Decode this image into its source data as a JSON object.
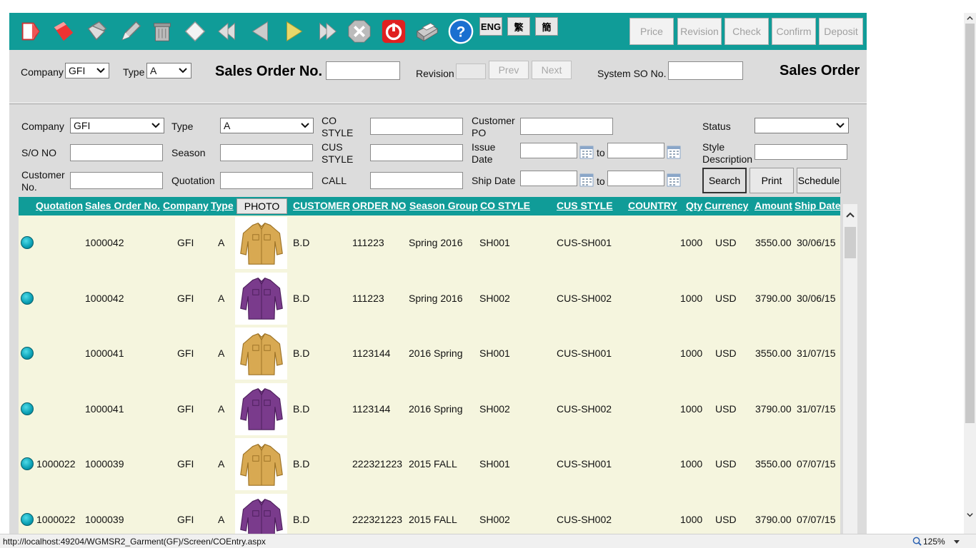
{
  "toolbar": {
    "icons": [
      "new-document-icon",
      "tag-icon",
      "duplicate-icon",
      "edit-pencil-icon",
      "delete-bin-icon",
      "diamond-icon",
      "first-record-icon",
      "previous-record-icon",
      "play-icon",
      "last-record-icon",
      "cancel-x-icon",
      "power-icon",
      "printer-icon",
      "help-icon"
    ],
    "lang": [
      "ENG",
      "繁",
      "簡"
    ],
    "workflow": [
      "Price",
      "Revision",
      "Check",
      "Confirm",
      "Deposit"
    ]
  },
  "header": {
    "company_label": "Company",
    "company_value": "GFI",
    "type_label": "Type",
    "type_value": "A",
    "so_label": "Sales Order No.",
    "revision_label": "Revision",
    "prev_label": "Prev",
    "next_label": "Next",
    "system_so_label": "System SO No.",
    "title": "Sales Order"
  },
  "filter": {
    "company_label": "Company",
    "company_value": "GFI",
    "type_label": "Type",
    "type_value": "A",
    "co_style_label": "CO STYLE",
    "customer_po_label": "Customer PO",
    "status_label": "Status",
    "so_no_label": "S/O NO",
    "season_label": "Season",
    "cus_style_label": "CUS STYLE",
    "issue_date_label": "Issue Date",
    "to_label": "to",
    "style_desc_label": "Style Description",
    "customer_no_label": "Customer No.",
    "quotation_label": "Quotation",
    "call_label": "CALL",
    "ship_date_label": "Ship Date",
    "search_btn": "Search",
    "print_btn": "Print",
    "schedule_btn": "Schedule"
  },
  "grid": {
    "columns": [
      "Quotation",
      "Sales Order No.",
      "Company",
      "Type",
      "PHOTO",
      "CUSTOMER",
      "ORDER NO",
      "Season Group",
      "CO STYLE",
      "CUS STYLE",
      "COUNTRY",
      "Qty",
      "Currency",
      "Amount",
      "Ship Date"
    ],
    "rows": [
      {
        "quotation": "",
        "so": "1000042",
        "company": "GFI",
        "type": "A",
        "photo": "yellow-shirt",
        "customer": "B.D",
        "order_no": "111223",
        "season": "Spring 2016",
        "co_style": "SH001",
        "cus_style": "CUS-SH001",
        "country": "",
        "qty": "1000",
        "currency": "USD",
        "amount": "3550.00",
        "ship": "30/06/15"
      },
      {
        "quotation": "",
        "so": "1000042",
        "company": "GFI",
        "type": "A",
        "photo": "purple-shirt",
        "customer": "B.D",
        "order_no": "111223",
        "season": "Spring 2016",
        "co_style": "SH002",
        "cus_style": "CUS-SH002",
        "country": "",
        "qty": "1000",
        "currency": "USD",
        "amount": "3790.00",
        "ship": "30/06/15"
      },
      {
        "quotation": "",
        "so": "1000041",
        "company": "GFI",
        "type": "A",
        "photo": "yellow-shirt",
        "customer": "B.D",
        "order_no": "1123144",
        "season": "2016 Spring",
        "co_style": "SH001",
        "cus_style": "CUS-SH001",
        "country": "",
        "qty": "1000",
        "currency": "USD",
        "amount": "3550.00",
        "ship": "31/07/15"
      },
      {
        "quotation": "",
        "so": "1000041",
        "company": "GFI",
        "type": "A",
        "photo": "purple-shirt",
        "customer": "B.D",
        "order_no": "1123144",
        "season": "2016 Spring",
        "co_style": "SH002",
        "cus_style": "CUS-SH002",
        "country": "",
        "qty": "1000",
        "currency": "USD",
        "amount": "3790.00",
        "ship": "31/07/15"
      },
      {
        "quotation": "1000022",
        "so": "1000039",
        "company": "GFI",
        "type": "A",
        "photo": "yellow-shirt",
        "customer": "B.D",
        "order_no": "222321223",
        "season": "2015 FALL",
        "co_style": "SH001",
        "cus_style": "CUS-SH001",
        "country": "",
        "qty": "1000",
        "currency": "USD",
        "amount": "3550.00",
        "ship": "07/07/15"
      },
      {
        "quotation": "1000022",
        "so": "1000039",
        "company": "GFI",
        "type": "A",
        "photo": "purple-shirt",
        "customer": "B.D",
        "order_no": "222321223",
        "season": "2015 FALL",
        "co_style": "SH002",
        "cus_style": "CUS-SH002",
        "country": "",
        "qty": "1000",
        "currency": "USD",
        "amount": "3790.00",
        "ship": "07/07/15"
      }
    ]
  },
  "statusbar": {
    "url": "http://localhost:49204/WGMSR2_Garment(GF)/Screen/COEntry.aspx",
    "zoom": "125%"
  },
  "colors": {
    "teal": "#109c98",
    "panel": "#dcdcdc",
    "row_bg": "#f5f5de"
  }
}
